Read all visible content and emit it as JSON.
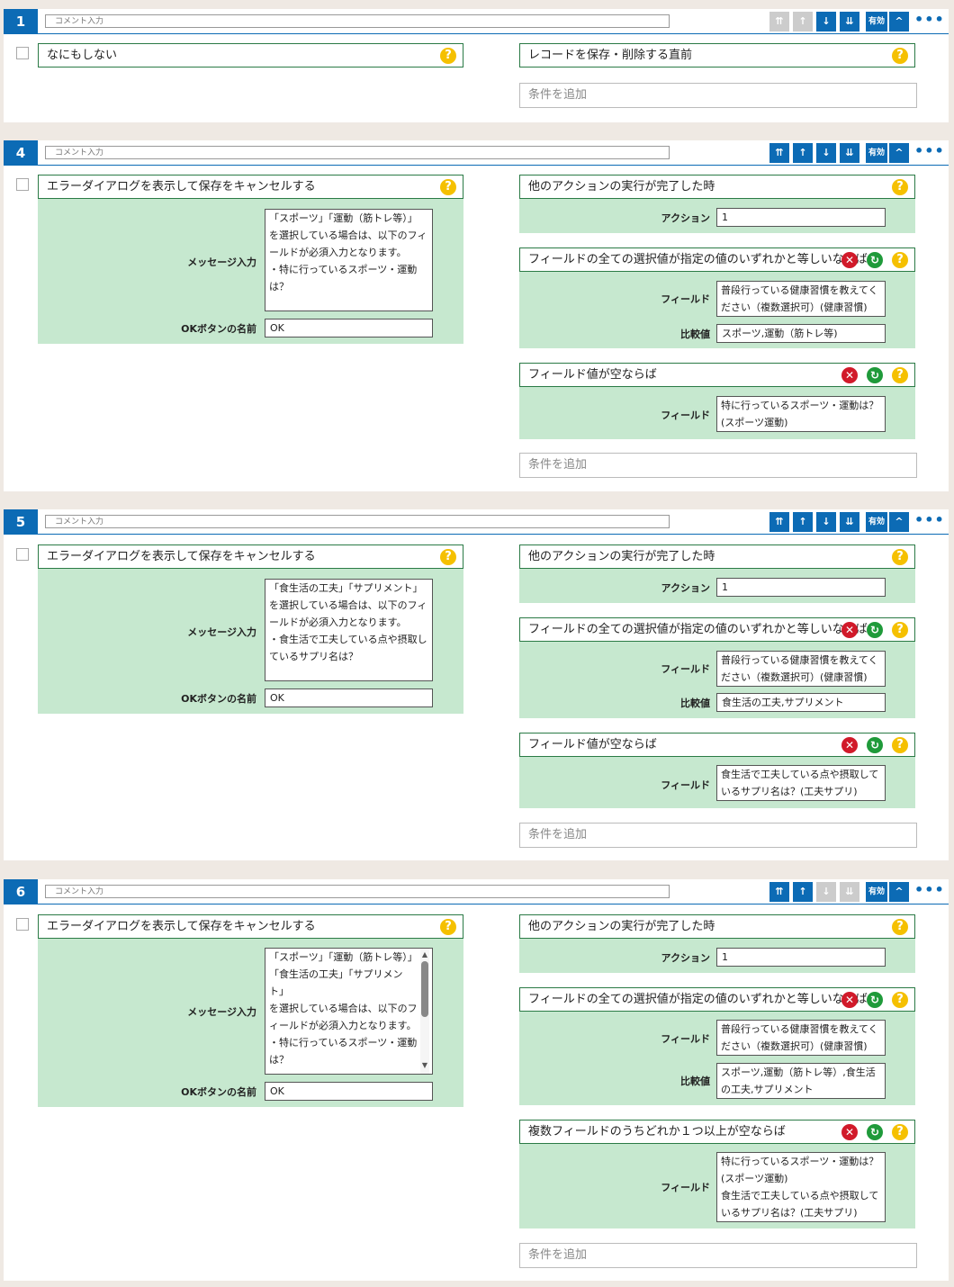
{
  "common": {
    "comment_placeholder": "コメント入力",
    "enabled_label": "有効",
    "add_condition": "条件を追加",
    "more": "•••",
    "help": "?",
    "delete": "✕",
    "refresh": "↻",
    "btn_top": "⇈",
    "btn_up": "↑",
    "btn_down": "↓",
    "btn_bottom": "⇊",
    "btn_collapse": "^"
  },
  "blocks": [
    {
      "number": "1",
      "action": "なにもしない",
      "trigger": "レコードを保存・削除する直前"
    },
    {
      "number": "4",
      "action": "エラーダイアログを表示して保存をキャンセルする",
      "message_label": "メッセージ入力",
      "message": "「スポーツ」「運動（筋トレ等）」\nを選択している場合は、以下のフィールドが必須入力となります。\n・特に行っているスポーツ・運動は？",
      "ok_label": "OKボタンの名前",
      "ok_value": "OK",
      "trigger": "他のアクションの実行が完了した時",
      "action_label": "アクション",
      "action_value": "1",
      "cond1_title": "フィールドの全ての選択値が指定の値のいずれかと等しいならば",
      "field_label": "フィールド",
      "cond1_field": "普段行っている健康習慣を教えてください（複数選択可）(健康習慣)",
      "compare_label": "比較値",
      "cond1_compare": "スポーツ,運動（筋トレ等)",
      "cond2_title": "フィールド値が空ならば",
      "cond2_field": "特に行っているスポーツ・運動は？(スポーツ運動)"
    },
    {
      "number": "5",
      "action": "エラーダイアログを表示して保存をキャンセルする",
      "message_label": "メッセージ入力",
      "message": "「食生活の工夫」「サプリメント」\nを選択している場合は、以下のフィールドが必須入力となります。\n・食生活で工夫している点や摂取しているサプリ名は？",
      "ok_label": "OKボタンの名前",
      "ok_value": "OK",
      "trigger": "他のアクションの実行が完了した時",
      "action_label": "アクション",
      "action_value": "1",
      "cond1_title": "フィールドの全ての選択値が指定の値のいずれかと等しいならば",
      "field_label": "フィールド",
      "cond1_field": "普段行っている健康習慣を教えてください（複数選択可）(健康習慣)",
      "compare_label": "比較値",
      "cond1_compare": "食生活の工夫,サプリメント",
      "cond2_title": "フィールド値が空ならば",
      "cond2_field": "食生活で工夫している点や摂取しているサプリ名は？(工夫サプリ)"
    },
    {
      "number": "6",
      "action": "エラーダイアログを表示して保存をキャンセルする",
      "message_label": "メッセージ入力",
      "message": "「スポーツ」「運動（筋トレ等）」\n「食生活の工夫」「サプリメント」\nを選択している場合は、以下のフィールドが必須入力となります。\n・特に行っているスポーツ・運動は？",
      "ok_label": "OKボタンの名前",
      "ok_value": "OK",
      "trigger": "他のアクションの実行が完了した時",
      "action_label": "アクション",
      "action_value": "1",
      "cond1_title": "フィールドの全ての選択値が指定の値のいずれかと等しいならば",
      "field_label": "フィールド",
      "cond1_field": "普段行っている健康習慣を教えてください（複数選択可）(健康習慣)",
      "compare_label": "比較値",
      "cond1_compare": "スポーツ,運動（筋トレ等）,食生活の工夫,サプリメント",
      "cond2_title": "複数フィールドのうちどれか１つ以上が空ならば",
      "cond2_field": "特に行っているスポーツ・運動は？(スポーツ運動)\n食生活で工夫している点や摂取しているサプリ名は？(工夫サプリ)"
    }
  ]
}
